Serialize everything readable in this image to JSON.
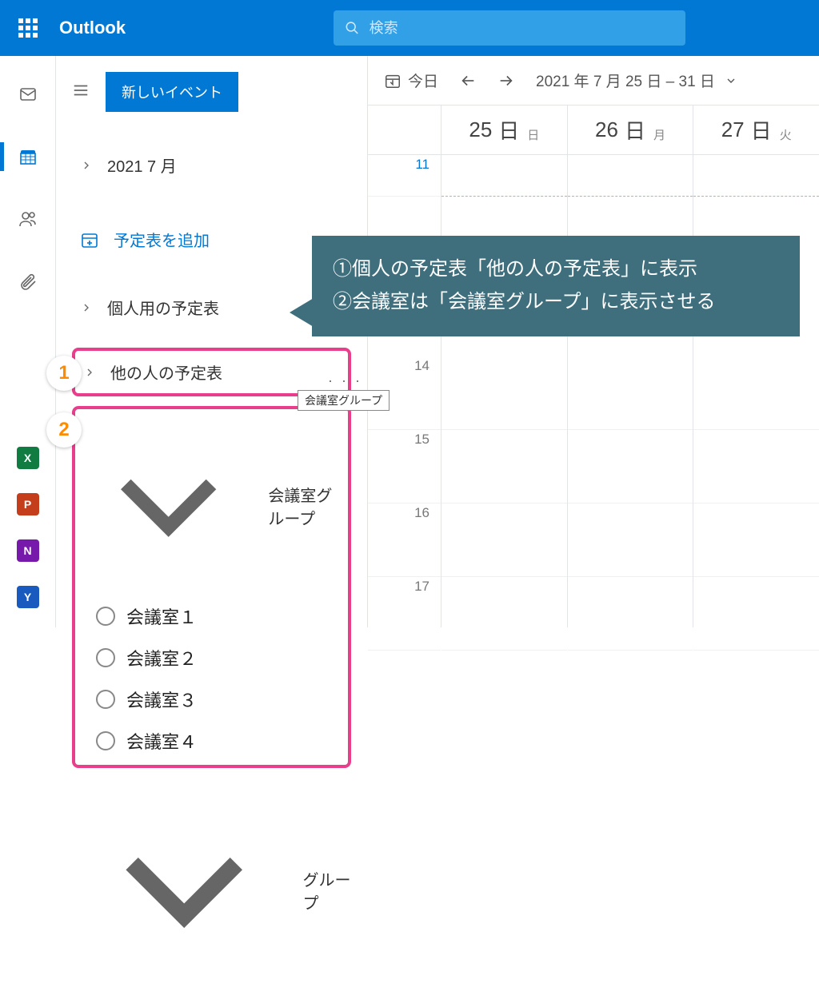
{
  "header": {
    "app_name": "Outlook",
    "search_placeholder": "検索"
  },
  "sidebar": {
    "new_event": "新しいイベント",
    "month_label": "2021 7 月",
    "add_calendar": "予定表を追加",
    "personal_cal": "個人用の予定表",
    "others_cal": "他の人の予定表",
    "meeting_group": "会議室グループ",
    "rooms": [
      "会議室１",
      "会議室２",
      "会議室３",
      "会議室４"
    ],
    "group_label": "グループ"
  },
  "badges": {
    "b1": "1",
    "b2": "2"
  },
  "toolbar": {
    "today": "今日",
    "date_range": "2021 年 7 月 25 日 – 31 日"
  },
  "days": [
    {
      "num": "25",
      "ch": "日",
      "wd": "日"
    },
    {
      "num": "26",
      "ch": "日",
      "wd": "月"
    },
    {
      "num": "27",
      "ch": "日",
      "wd": "火"
    }
  ],
  "hours": {
    "first": "11",
    "rest": [
      "14",
      "15",
      "16",
      "17"
    ]
  },
  "tooltip": "会議室グループ",
  "callout": {
    "line1": "①個人の予定表「他の人の予定表」に表示",
    "line2": "②会議室は「会議室グループ」に表示させる"
  },
  "app_icons": [
    {
      "label": "X",
      "bg": "#107c41"
    },
    {
      "label": "P",
      "bg": "#c43e1c"
    },
    {
      "label": "N",
      "bg": "#7719aa"
    },
    {
      "label": "Y",
      "bg": "#185abd"
    }
  ]
}
